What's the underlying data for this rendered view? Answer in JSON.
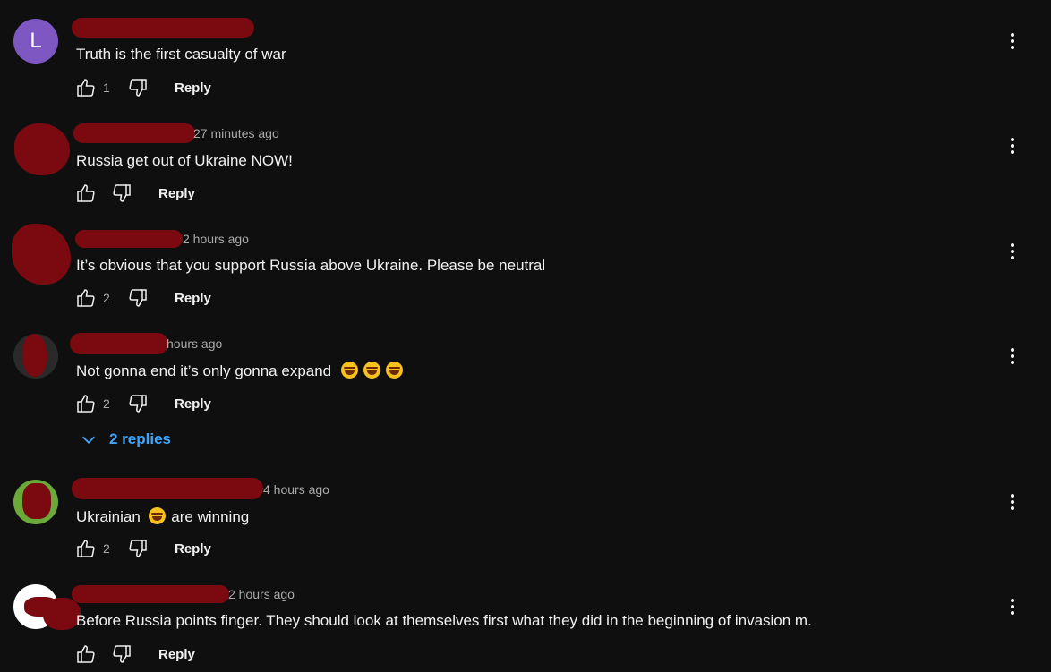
{
  "comments": [
    {
      "avatar_letter": "L",
      "avatar_color": "#7e57c2",
      "meta": "",
      "text": "Truth is the first casualty of war",
      "like_count": "1",
      "reply_label": "Reply"
    },
    {
      "avatar_letter": "",
      "avatar_color": "#6a0a10",
      "meta": "27 minutes ago",
      "text": "Russia get out of Ukraine NOW!",
      "like_count": "",
      "reply_label": "Reply"
    },
    {
      "avatar_letter": "",
      "avatar_color": "#6a0a10",
      "meta": "2 hours ago",
      "text": "It’s  obvious that you support Russia above Ukraine. Please be neutral",
      "like_count": "2",
      "reply_label": "Reply"
    },
    {
      "avatar_letter": "",
      "avatar_color": "#2a2a2a",
      "meta": "hours ago",
      "text": "Not gonna end it’s only gonna expand",
      "like_count": "2",
      "reply_label": "Reply",
      "replies_label": "2 replies"
    },
    {
      "avatar_letter": "",
      "avatar_color": "#6aaa3a",
      "meta": "4 hours ago",
      "text_before": "Ukrainian",
      "text_after": "are winning",
      "like_count": "2",
      "reply_label": "Reply"
    },
    {
      "avatar_letter": "",
      "avatar_color": "#ffffff",
      "meta": "2 hours ago",
      "text": "Before Russia points finger. They should look at themselves first what they did in the beginning of invasion m.",
      "like_count": "",
      "reply_label": "Reply"
    }
  ],
  "colors": {
    "background": "#0f0f0f",
    "link_blue": "#3ea6ff",
    "redaction": "#7a0a10"
  },
  "icons": [
    "thumbs-up-icon",
    "thumbs-down-icon",
    "more-vert-icon",
    "chevron-down-icon",
    "laughing-emoji-icon"
  ]
}
